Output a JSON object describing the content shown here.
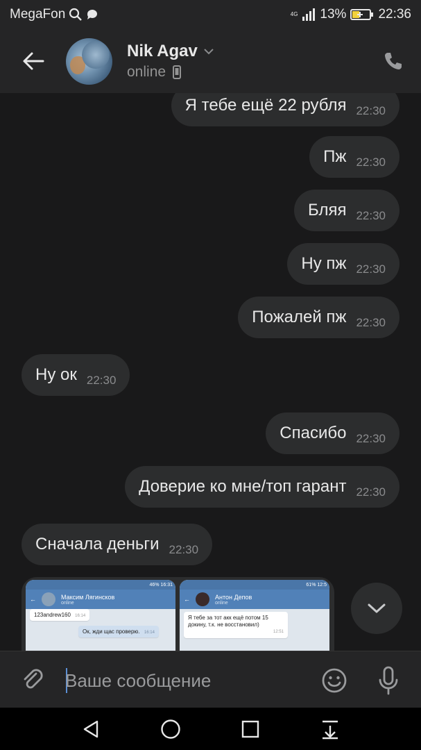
{
  "status_bar": {
    "carrier": "MegaFon",
    "network": "4G",
    "battery": "13%",
    "time": "22:36"
  },
  "header": {
    "contact_name": "Nik Agav",
    "contact_status": "online"
  },
  "messages": [
    {
      "direction": "out",
      "text": "Я тебе ещё 22 рубля",
      "time": "22:30"
    },
    {
      "direction": "out",
      "text": "Пж",
      "time": "22:30"
    },
    {
      "direction": "out",
      "text": "Бляя",
      "time": "22:30"
    },
    {
      "direction": "out",
      "text": "Ну пж",
      "time": "22:30"
    },
    {
      "direction": "out",
      "text": "Пожалей пж",
      "time": "22:30"
    },
    {
      "direction": "in",
      "text": "Ну ок",
      "time": "22:30"
    },
    {
      "direction": "out",
      "text": "Спасибо",
      "time": "22:30"
    },
    {
      "direction": "out",
      "text": "Доверие ко мне/топ гарант",
      "time": "22:30"
    },
    {
      "direction": "in",
      "text": "Сначала деньги",
      "time": "22:30"
    }
  ],
  "attachment": {
    "shot1": {
      "status": "46% 16:31",
      "name": "Максим Лягинсков",
      "online": "online",
      "msg_top": "123andrew160",
      "msg_top_time": "16:14",
      "msg_out": "Ок, жди щас проверю.",
      "msg_out_time": "16:14"
    },
    "shot2": {
      "status": "61% 12:5",
      "name": "Антон Депов",
      "online": "online",
      "msg": "Я тебе за тот акк ещё потом 15 докину, т.к. не восстановил)",
      "msg_time": "12:51"
    }
  },
  "composer": {
    "placeholder": "Ваше сообщение"
  },
  "colors": {
    "background": "#19191a",
    "bubble": "#2c2d2e",
    "header": "#252526",
    "accent": "#5b8fd6"
  }
}
